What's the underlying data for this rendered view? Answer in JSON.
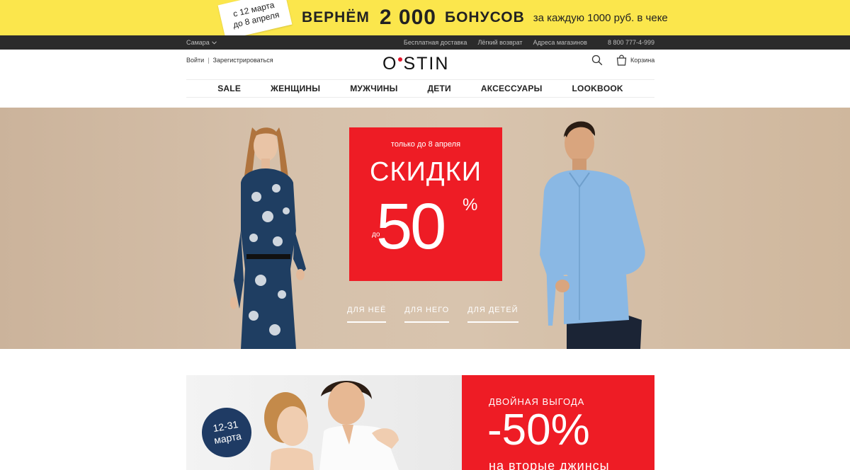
{
  "promo": {
    "date_line1": "с 12 марта",
    "date_line2": "до 8 апреля",
    "lead": "ВЕРНЁМ",
    "amount": "2 000",
    "word": "БОНУСОВ",
    "tail": "за каждую 1000 руб. в чеке"
  },
  "utility": {
    "city": "Самара",
    "links": [
      "Бесплатная доставка",
      "Лёгкий возврат",
      "Адреса магазинов"
    ],
    "phone": "8 800 777-4-999"
  },
  "header": {
    "login": "Войти",
    "register": "Зарегистрироваться",
    "logo_left": "O",
    "logo_right": "STIN",
    "cart": "Корзина"
  },
  "nav": [
    "SALE",
    "ЖЕНЩИНЫ",
    "МУЖЧИНЫ",
    "ДЕТИ",
    "АКСЕССУАРЫ",
    "LOOKBOOK"
  ],
  "hero": {
    "until": "только до 8 апреля",
    "headline": "СКИДКИ",
    "prefix": "до",
    "value": "50",
    "percent": "%",
    "links": [
      "ДЛЯ НЕЁ",
      "ДЛЯ НЕГО",
      "ДЛЯ ДЕТЕЙ"
    ]
  },
  "banner2": {
    "badge_line1": "12-31",
    "badge_line2": "марта",
    "title": "ДВОЙНАЯ ВЫГОДА",
    "discount": "-50%",
    "subtitle": "на вторые джинсы"
  },
  "colors": {
    "promo_yellow": "#fbe64c",
    "accent_red": "#ee1c25",
    "utility_dark": "#2b2b2b"
  }
}
